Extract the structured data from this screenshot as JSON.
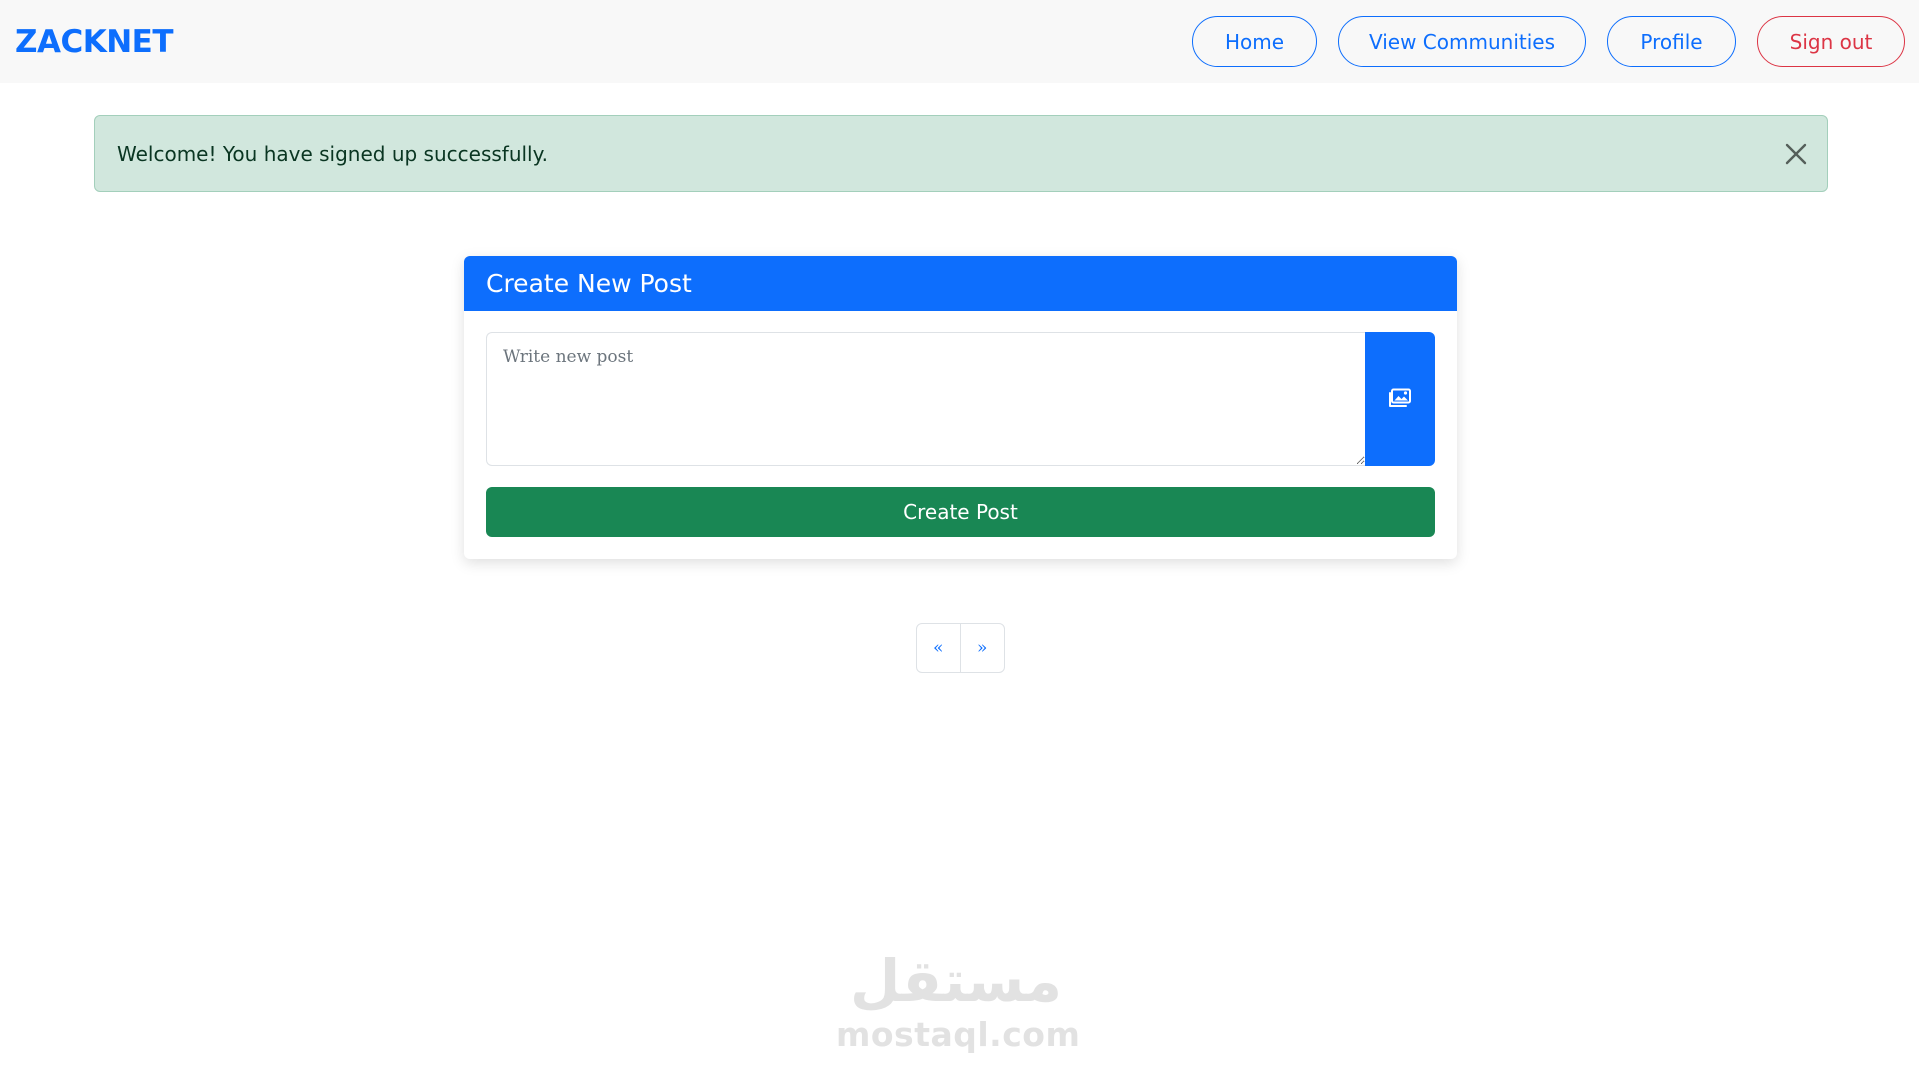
{
  "navbar": {
    "brand": "ZACKNET",
    "links": {
      "home": "Home",
      "communities": "View Communities",
      "profile": "Profile",
      "signout": "Sign out"
    }
  },
  "alert": {
    "message": "Welcome! You have signed up successfully.",
    "close_icon": "close-icon"
  },
  "post_form": {
    "title": "Create New Post",
    "placeholder": "Write new post",
    "image_icon": "images-icon",
    "submit_label": "Create Post"
  },
  "pagination": {
    "prev": "«",
    "next": "»"
  },
  "watermark": {
    "arabic": "مستقل",
    "latin": "mostaql.com"
  },
  "colors": {
    "primary": "#0d6efd",
    "success": "#198754",
    "danger": "#dc3545",
    "alert_bg": "#d1e7dd",
    "navbar_bg": "#f8f8f8"
  }
}
